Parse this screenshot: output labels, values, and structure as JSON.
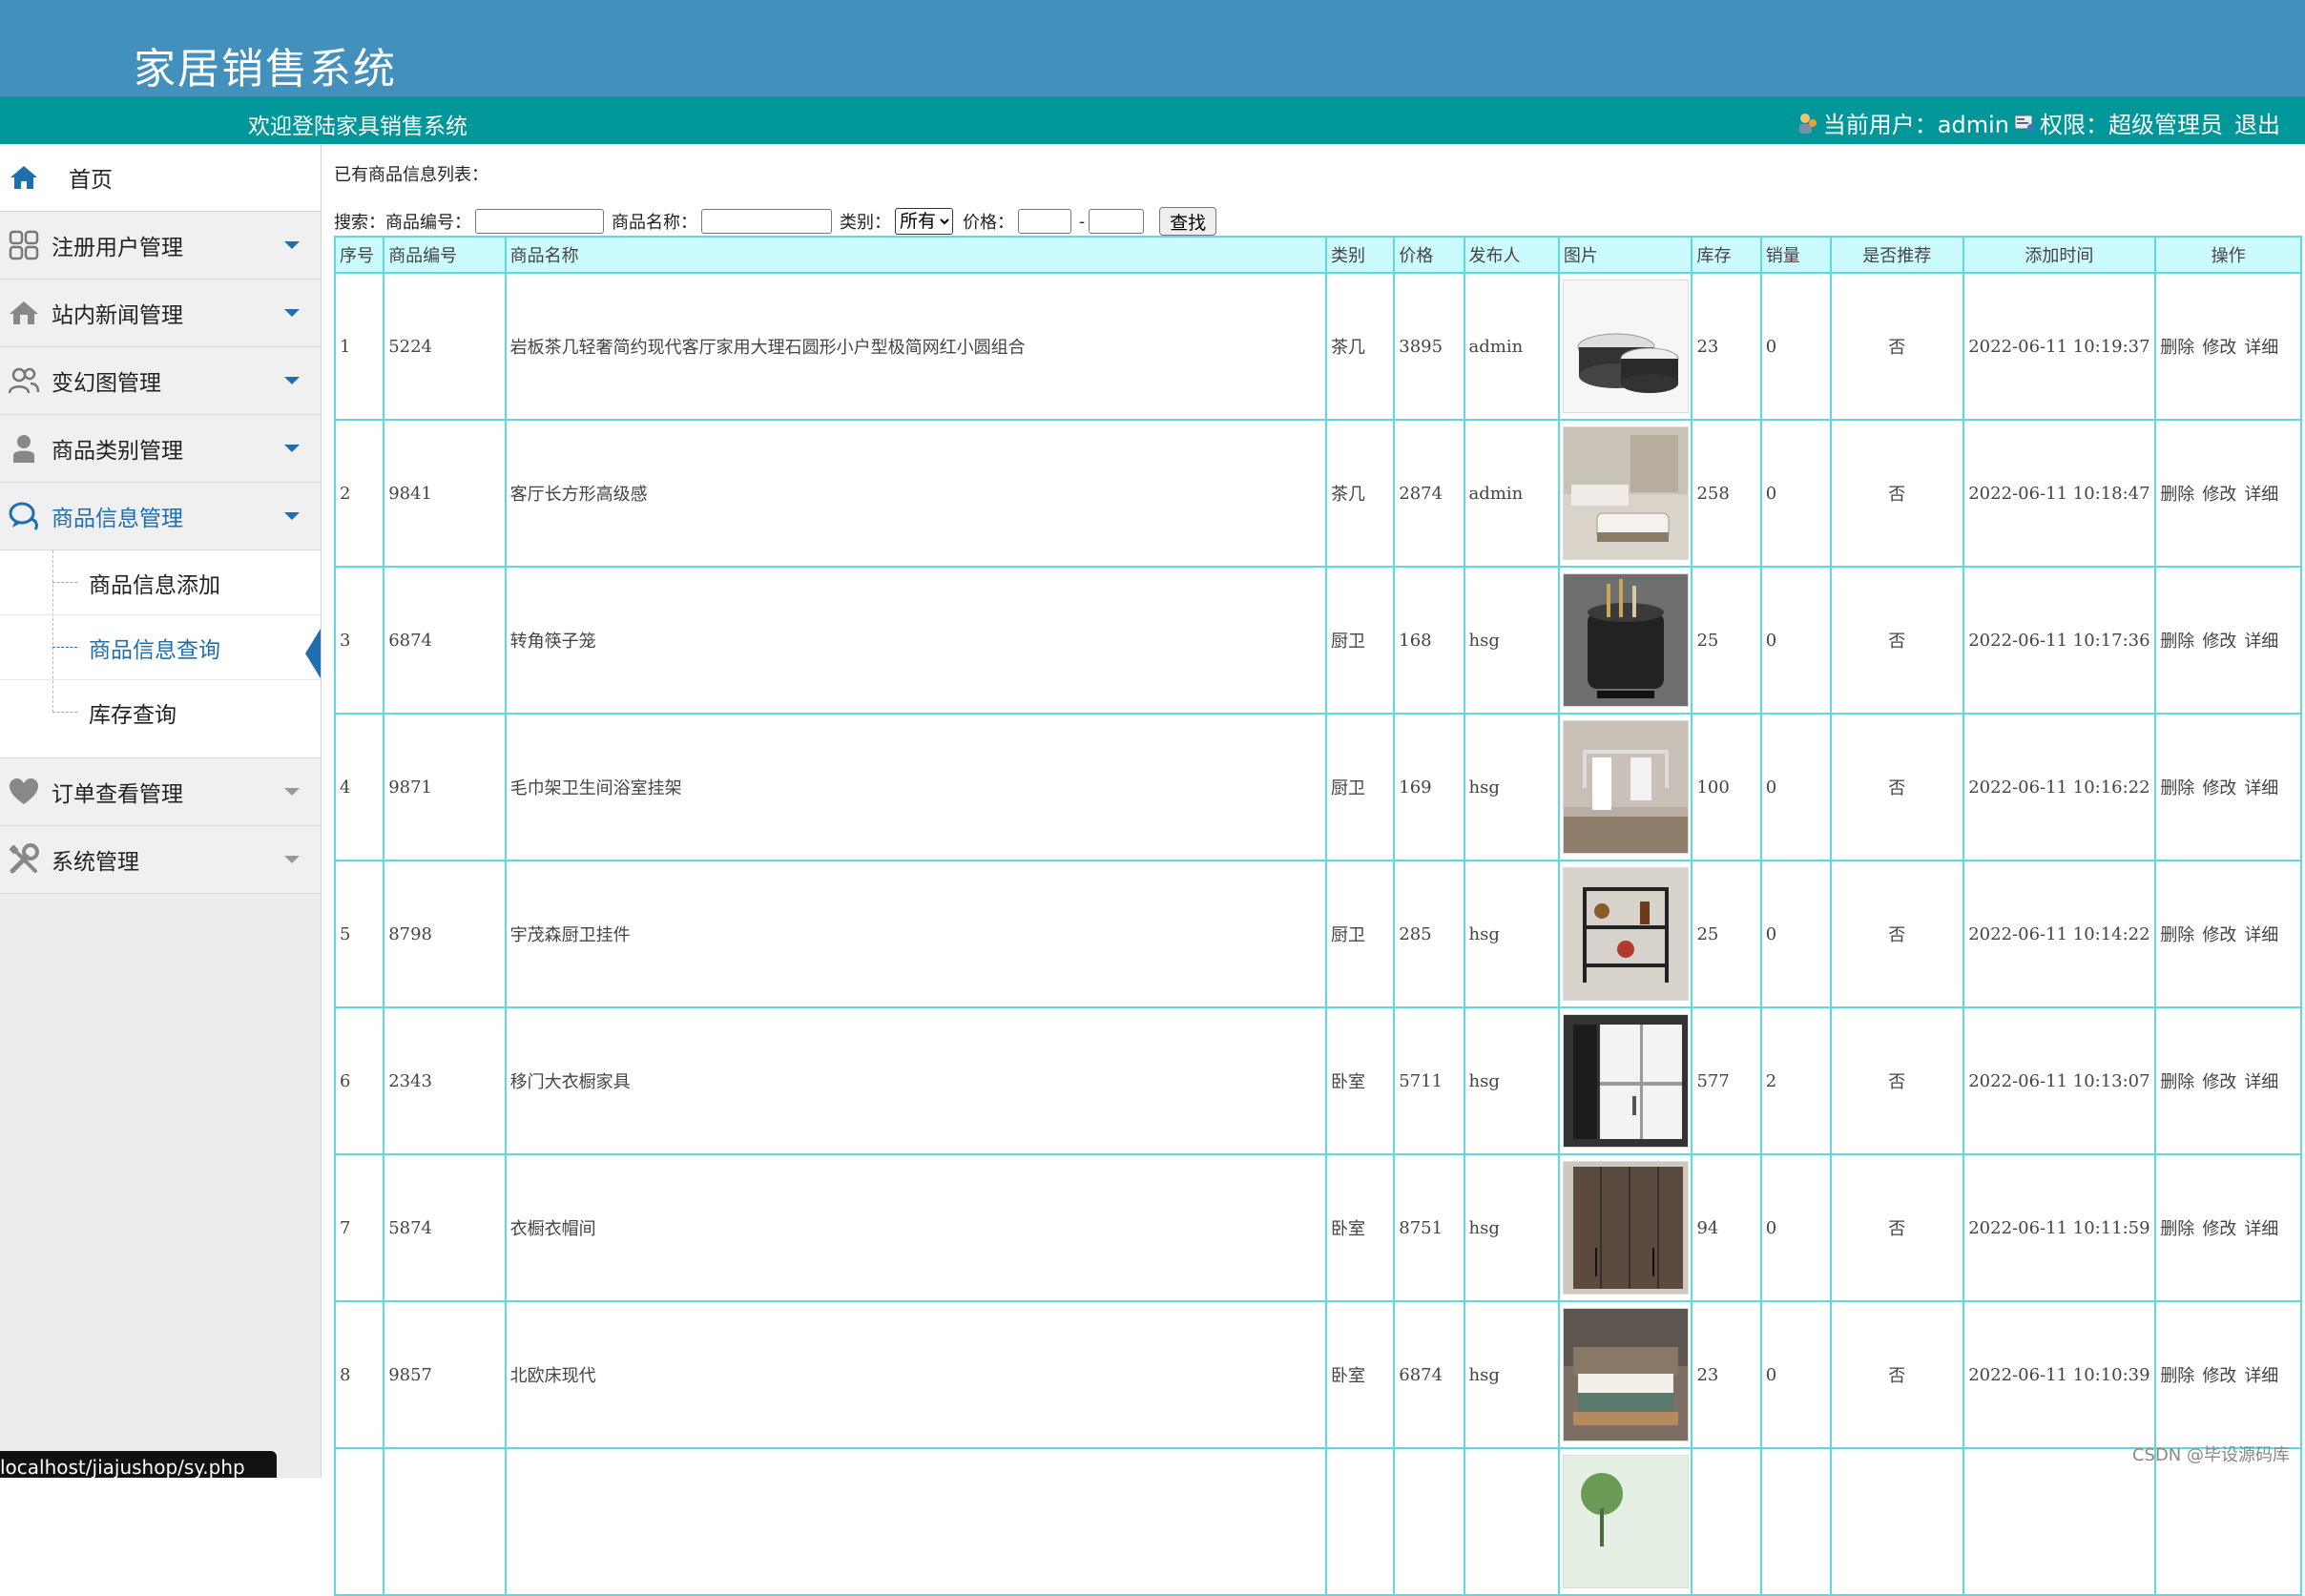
{
  "app": {
    "title": "家居销售系统",
    "welcome": "欢迎登陆家具销售系统",
    "current_user_label": "当前用户：admin",
    "permission_label": "权限：超级管理员",
    "logout_label": "退出"
  },
  "sidebar": {
    "items": [
      {
        "label": "首页",
        "icon": "home-icon"
      },
      {
        "label": "注册用户管理",
        "icon": "grid-icon"
      },
      {
        "label": "站内新闻管理",
        "icon": "house-icon"
      },
      {
        "label": "变幻图管理",
        "icon": "users-icon"
      },
      {
        "label": "商品类别管理",
        "icon": "user-icon"
      },
      {
        "label": "商品信息管理",
        "icon": "chat-icon"
      },
      {
        "label": "订单查看管理",
        "icon": "heart-icon"
      },
      {
        "label": "系统管理",
        "icon": "tools-icon"
      }
    ],
    "submenu": [
      "商品信息添加",
      "商品信息查询",
      "库存查询"
    ]
  },
  "main": {
    "caption": "已有商品信息列表：",
    "search": {
      "label": "搜索：",
      "code_label": "商品编号：",
      "name_label": "商品名称：",
      "category_label": "类别：",
      "category_value": "所有",
      "price_label": "价格：",
      "price_sep": "-",
      "button": "查找"
    },
    "columns": [
      "序号",
      "商品编号",
      "商品名称",
      "类别",
      "价格",
      "发布人",
      "图片",
      "库存",
      "销量",
      "是否推荐",
      "添加时间",
      "操作"
    ],
    "actions": [
      "删除",
      "修改",
      "详细"
    ],
    "rows": [
      {
        "no": "1",
        "code": "5224",
        "name": "岩板茶几轻奢简约现代客厅家用大理石圆形小户型极简网红小圆组合",
        "category": "茶几",
        "price": "3895",
        "publisher": "admin",
        "image": "round-coffee-table",
        "stock": "23",
        "sales": "0",
        "recommend": "否",
        "time": "2022-06-11 10:19:37"
      },
      {
        "no": "2",
        "code": "9841",
        "name": "客厅长方形高级感",
        "category": "茶几",
        "price": "2874",
        "publisher": "admin",
        "image": "living-room-table",
        "stock": "258",
        "sales": "0",
        "recommend": "否",
        "time": "2022-06-11 10:18:47"
      },
      {
        "no": "3",
        "code": "6874",
        "name": "转角筷子笼",
        "category": "厨卫",
        "price": "168",
        "publisher": "hsg",
        "image": "chopstick-holder",
        "stock": "25",
        "sales": "0",
        "recommend": "否",
        "time": "2022-06-11 10:17:36"
      },
      {
        "no": "4",
        "code": "9871",
        "name": "毛巾架卫生间浴室挂架",
        "category": "厨卫",
        "price": "169",
        "publisher": "hsg",
        "image": "towel-rack",
        "stock": "100",
        "sales": "0",
        "recommend": "否",
        "time": "2022-06-11 10:16:22"
      },
      {
        "no": "5",
        "code": "8798",
        "name": "宇茂森厨卫挂件",
        "category": "厨卫",
        "price": "285",
        "publisher": "hsg",
        "image": "kitchen-shelf",
        "stock": "25",
        "sales": "0",
        "recommend": "否",
        "time": "2022-06-11 10:14:22"
      },
      {
        "no": "6",
        "code": "2343",
        "name": "移门大衣橱家具",
        "category": "卧室",
        "price": "5711",
        "publisher": "hsg",
        "image": "sliding-wardrobe",
        "stock": "577",
        "sales": "2",
        "recommend": "否",
        "time": "2022-06-11 10:13:07"
      },
      {
        "no": "7",
        "code": "5874",
        "name": "衣橱衣帽间",
        "category": "卧室",
        "price": "8751",
        "publisher": "hsg",
        "image": "dark-wardrobe",
        "stock": "94",
        "sales": "0",
        "recommend": "否",
        "time": "2022-06-11 10:11:59"
      },
      {
        "no": "8",
        "code": "9857",
        "name": "北欧床现代",
        "category": "卧室",
        "price": "6874",
        "publisher": "hsg",
        "image": "nordic-bed",
        "stock": "23",
        "sales": "0",
        "recommend": "否",
        "time": "2022-06-11 10:10:39"
      },
      {
        "no": "",
        "code": "",
        "name": "",
        "category": "",
        "price": "",
        "publisher": "",
        "image": "plant-room",
        "stock": "",
        "sales": "",
        "recommend": "",
        "time": ""
      }
    ]
  },
  "status_url": "localhost/jiajushop/sy.php",
  "watermark": "CSDN @毕设源码库",
  "colors": {
    "banner": "#4490bc",
    "welcome_bar": "#00979a",
    "accent": "#1f6fb0",
    "table_border": "#5fd9df",
    "table_header": "#ccfbff"
  }
}
